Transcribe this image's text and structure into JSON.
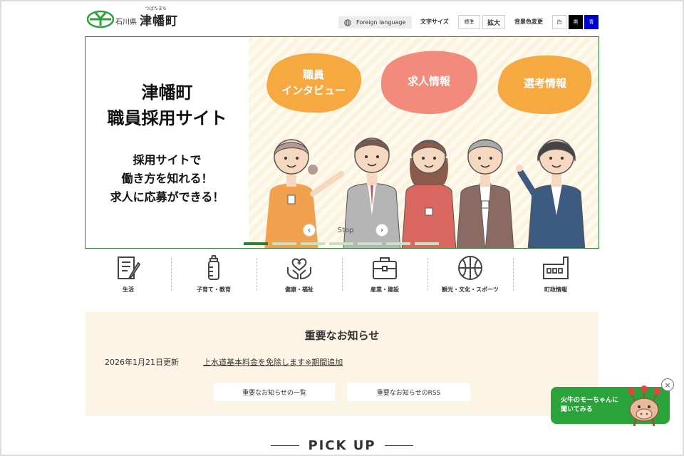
{
  "header": {
    "logo_pref": "石川県",
    "logo_ruby": "つばたまち",
    "logo_town": "津幡町",
    "foreign_language": "Foreign language",
    "text_size_label": "文字サイズ",
    "text_size_standard": "標準",
    "text_size_large": "拡大",
    "bg_color_label": "背景色変更",
    "bg_white": "白",
    "bg_black": "黒",
    "bg_blue": "青"
  },
  "hero": {
    "title_line1": "津幡町",
    "title_line2": "職員採用サイト",
    "sub_line1": "採用サイトで",
    "sub_line2": "働き方を知れる！",
    "sub_line3": "求人に応募ができる！",
    "bubble1_line1": "職員",
    "bubble1_line2": "インタビュー",
    "bubble2": "求人情報",
    "bubble3": "選考情報",
    "prev": "‹",
    "next": "›",
    "stop": "Stop",
    "slide_count": 7,
    "active_slide": 1
  },
  "categories": [
    {
      "label": "生活",
      "icon": "document-pen-icon"
    },
    {
      "label": "子育て・教育",
      "icon": "baby-bottle-icon"
    },
    {
      "label": "健康・福祉",
      "icon": "heart-hands-icon"
    },
    {
      "label": "産業・建設",
      "icon": "briefcase-icon"
    },
    {
      "label": "観光・文化・スポーツ",
      "icon": "basketball-icon"
    },
    {
      "label": "町政情報",
      "icon": "factory-icon"
    }
  ],
  "notice": {
    "title": "重要なお知らせ",
    "date": "2026年1月21日更新",
    "link": "上水道基本料金を免除します※期間追加",
    "list_button": "重要なお知らせの一覧",
    "rss_button": "重要なお知らせのRSS"
  },
  "pickup": {
    "title": "PICK UP"
  },
  "chat": {
    "line1": "火牛のモーちゃんに",
    "line2": "聞いてみる",
    "close": "×"
  },
  "colors": {
    "brand_green": "#2e7d3a",
    "notice_bg": "#fcf4e5",
    "chat_green": "#2aa33a",
    "bubble_orange": "#f7a941",
    "bubble_pink": "#f28b7b"
  }
}
